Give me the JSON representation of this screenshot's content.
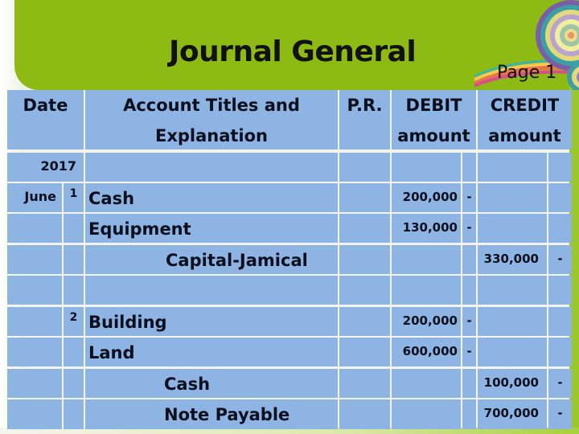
{
  "slide": {
    "title": "Journal General",
    "page_label": "Page 1"
  },
  "table": {
    "headers": {
      "date": "Date",
      "account": "Account Titles and Explanation",
      "account_line1": "Account Titles and",
      "account_line2": "Explanation",
      "pr": "P.R.",
      "debit_line1": "DEBIT",
      "debit_line2": "amount",
      "credit_line1": "CREDIT",
      "credit_line2": "amount"
    },
    "year": "2017",
    "rows": [
      {
        "month": "June",
        "day": "1",
        "account": "Cash",
        "indent": false,
        "pr": "",
        "debit": "200,000",
        "debit_cents": "-",
        "credit": "",
        "credit_cents": ""
      },
      {
        "month": "",
        "day": "",
        "account": "Equipment",
        "indent": false,
        "pr": "",
        "debit": "130,000",
        "debit_cents": "-",
        "credit": "",
        "credit_cents": ""
      },
      {
        "month": "",
        "day": "",
        "account": "Capital-Jamical",
        "indent": true,
        "pr": "",
        "debit": "",
        "debit_cents": "",
        "credit": "330,000",
        "credit_cents": "-"
      },
      {
        "month": "",
        "day": "",
        "account": "",
        "indent": false,
        "pr": "",
        "debit": "",
        "debit_cents": "",
        "credit": "",
        "credit_cents": ""
      },
      {
        "month": "",
        "day": "2",
        "account": "Building",
        "indent": false,
        "pr": "",
        "debit": "200,000",
        "debit_cents": "-",
        "credit": "",
        "credit_cents": ""
      },
      {
        "month": "",
        "day": "",
        "account": "Land",
        "indent": false,
        "pr": "",
        "debit": "600,000",
        "debit_cents": "-",
        "credit": "",
        "credit_cents": ""
      },
      {
        "month": "",
        "day": "",
        "account": "Cash",
        "indent": true,
        "pr": "",
        "debit": "",
        "debit_cents": "",
        "credit": "100,000",
        "credit_cents": "-"
      },
      {
        "month": "",
        "day": "",
        "account": "Note Payable",
        "indent": true,
        "pr": "",
        "debit": "",
        "debit_cents": "",
        "credit": "700,000",
        "credit_cents": "-"
      }
    ]
  },
  "colors": {
    "accent_green": "#8dbb14",
    "table_blue": "#8eb4e3",
    "text_dark": "#0a0f1e"
  },
  "icons": {
    "decoration": "concentric-circles-swirl"
  }
}
